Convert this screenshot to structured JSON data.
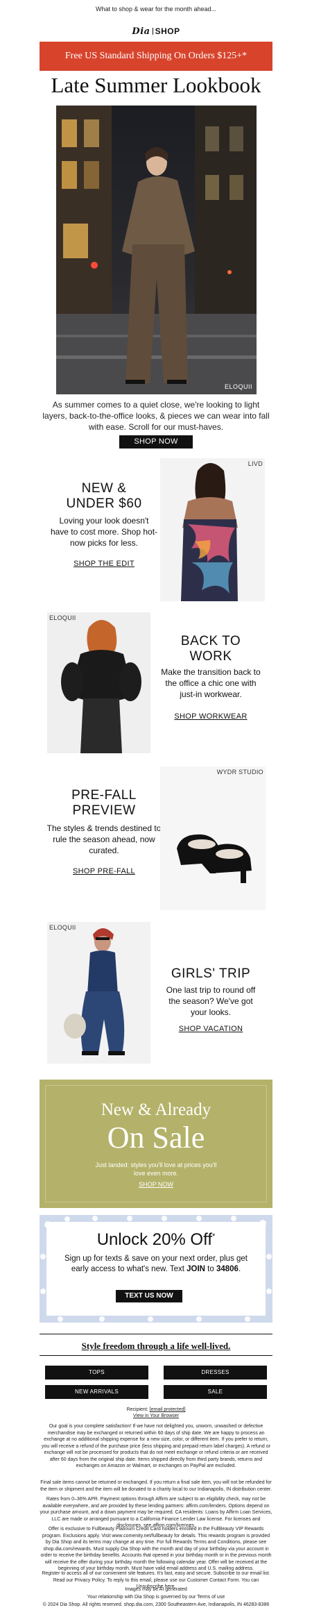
{
  "preheader": "What to shop & wear for the month ahead...",
  "logo": {
    "brand": "Dia",
    "shop": "SHOP"
  },
  "banner": "Free US Standard Shipping On Orders $125+*",
  "title": "Late Summer Lookbook",
  "hero": {
    "label": "ELOQUII"
  },
  "intro": "As summer comes to a quiet close, we're looking to light layers, back-to-the-office looks, & pieces we can wear into fall with ease. Scroll for our must-haves.",
  "shop_now": "SHOP NOW",
  "sections": {
    "new_under": {
      "heading_line1": "NEW &",
      "heading_line2": "UNDER $60",
      "body": "Loving your look doesn't have to cost more. Shop hot-now picks for less.",
      "link": "SHOP THE EDIT",
      "image_label": "LIVD"
    },
    "back_to_work": {
      "heading_line1": "BACK TO",
      "heading_line2": "WORK",
      "body": "Make the transition back to the office a chic one with just-in workwear.",
      "link": "SHOP WORKWEAR",
      "image_label": "ELOQUII"
    },
    "pre_fall": {
      "heading_line1": "PRE-FALL",
      "heading_line2": "PREVIEW",
      "body": "The styles & trends destined to rule the season ahead, now curated.",
      "link": "SHOP PRE-FALL",
      "image_label": "WYDR STUDIO"
    },
    "girls_trip": {
      "heading": "GIRLS' TRIP",
      "body": "One last trip to round off the season? We've got your looks.",
      "link": "SHOP VACATION",
      "image_label": "ELOQUII"
    }
  },
  "sale": {
    "line1": "New & Already",
    "line2": "On Sale",
    "body": "Just landed: styles you'll love at prices you'll love even more.",
    "link": "SHOP NOW"
  },
  "unlock": {
    "heading": "Unlock 20% Off",
    "heading_mark": "*",
    "body_pre": "Sign up for texts & save on your next order, plus get early access to what's new. Text ",
    "keyword": "JOIN",
    "body_mid": " to ",
    "number": "34806",
    "body_end": ".",
    "button": "TEXT US NOW"
  },
  "freedom": "Style freedom through a life well-lived.",
  "nav": [
    "TOPS",
    "DRESSES",
    "NEW ARRIVALS",
    "SALE"
  ],
  "footer": {
    "recipient_label": "Recipient:",
    "recipient_value": "[email protected]",
    "view_browser": "View in Your Browser",
    "returns": "Our goal is your complete satisfaction! If we have not delighted you, unworn, unwashed or defective merchandise may be exchanged or returned within 60 days of ship date. We are happy to process an exchange at no additional shipping expense for a new size, color, or different item. If you prefer to return, you will receive a refund of the purchase price (less shipping and prepaid return label charges). A refund or exchange will not be processed for products that do not meet exchange or refund criteria or are received after 60 days from the original ship date. Items shipped directly from third party brands, returns and exchanges on Amazon or Walmart, or exchanges on PayPal are excluded.",
    "final_sale": "Final sale items cannot be returned or exchanged. If you return a final sale item, you will not be refunded for the item or shipment and the item will be donated to a charity local to our Indianapolis, IN distribution center.",
    "rates": "Rates from 0–36% APR. Payment options through Affirm are subject to an eligibility check, may not be available everywhere, and are provided by these lending partners: affirm.com/lenders. Options depend on your purchase amount, and a down payment may be required. CA residents: Loans by Affirm Loan Services, LLC are made or arranged pursuant to a California Finance Lender Law license. For licenses and disclosures, see affirm.com/licenses.",
    "offer": "Offer is exclusive to Fullbeauty Platinum Credit Card holders enrolled in the FullBeauty VIP Rewards program. Exclusions apply. Visit www.comenity.net/fullbeauty for details. This rewards program is provided by Dia Shop and its terms may change at any time. For full Rewards Terms and Conditions, please see shop.dia.com/rewards. Must supply Dia Shop with the month and day of your birthday via your account in order to receive the birthday benefits. Accounts that opened in your birthday month or in the previous month will receive the offer during your birthday month the following calendar year. Offer will be received at the beginning of your birthday month. Must have valid email address and U.S. mailing address.",
    "register": "Register to access all of our convenient site features. It's fast, easy and secure. Subscribe to our email list. Read our Privacy Policy. To reply to this email, please use our Customer Contact Form. You can Unsubscribe here.",
    "ai": "Images may be AI generated",
    "terms": "Your relationship with Dia Shop is governed by our Terms of use",
    "copyright": "© 2024 Dia Shop. All rights reserved. shop.dia.com, 2300 Southeastern Ave, Indianapolis, IN 46283-8386"
  },
  "colors": {
    "banner": "#d8432c",
    "sale_bg": "#b4b26a",
    "unlock_bg": "#cfd9ec",
    "button": "#111111"
  }
}
